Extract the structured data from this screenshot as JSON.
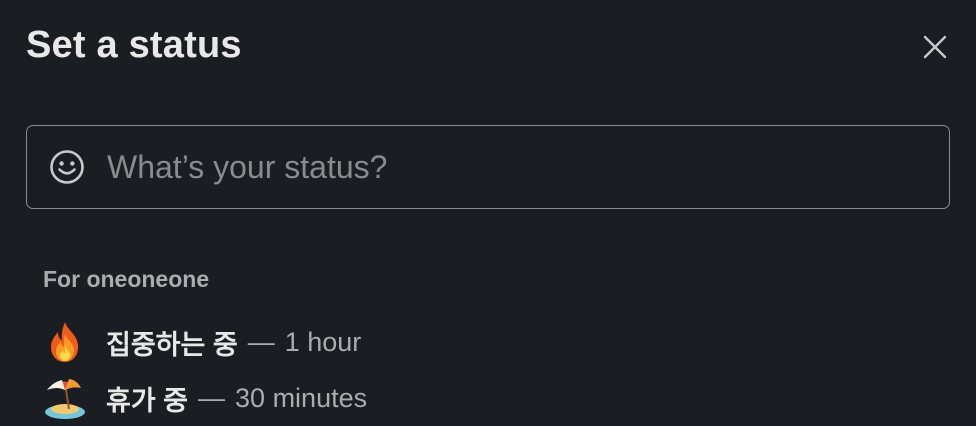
{
  "dialog": {
    "title": "Set a status",
    "close_icon": "close-icon"
  },
  "status_input": {
    "placeholder": "What’s your status?",
    "value": "",
    "emoji_icon": "smiley-icon"
  },
  "presets_section": {
    "label": "For oneoneone",
    "items": [
      {
        "icon": "fire-emoji-icon",
        "name": "집중하는 중",
        "separator": "—",
        "duration": "1 hour"
      },
      {
        "icon": "beach-umbrella-emoji-icon",
        "name": "휴가 중",
        "separator": "—",
        "duration": "30 minutes"
      }
    ]
  },
  "colors": {
    "background": "#1a1d21",
    "title": "#e8e8e8",
    "muted": "#abacad",
    "border": "#8a8b8d"
  }
}
